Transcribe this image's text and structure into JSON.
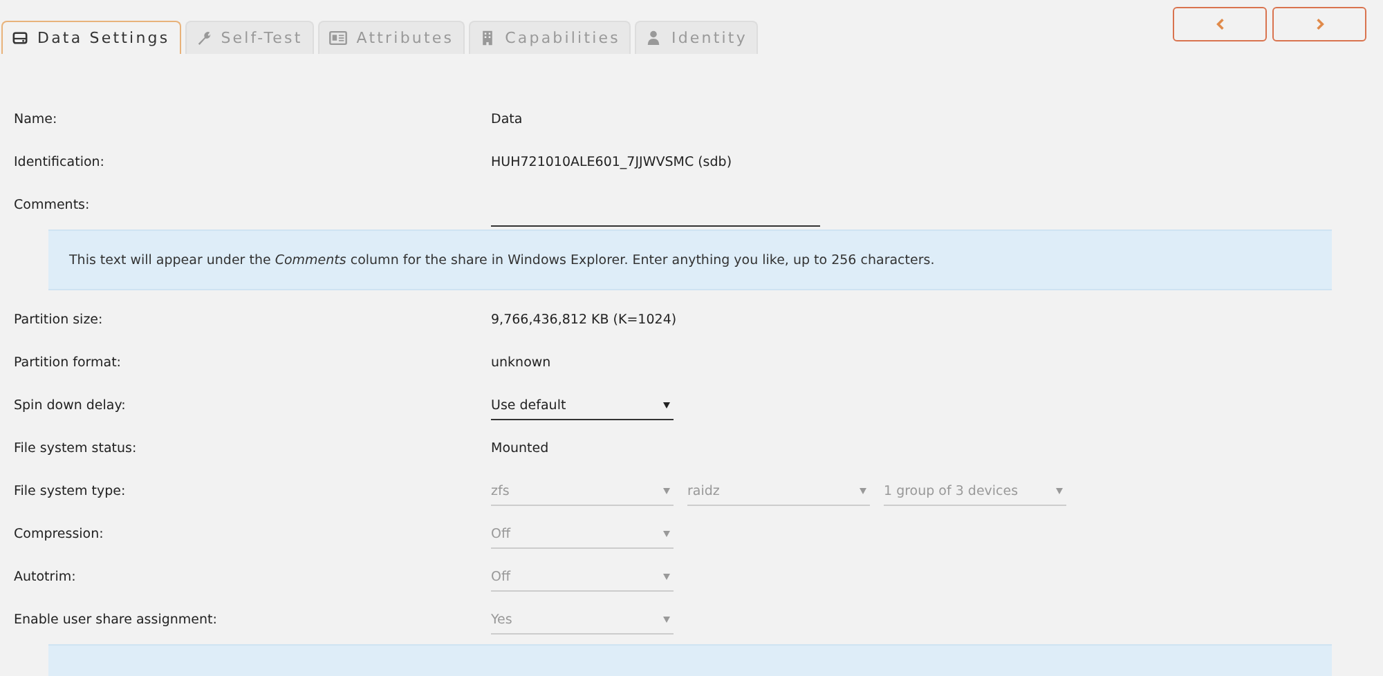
{
  "tabs": [
    {
      "label": "Data Settings",
      "kind": "drive",
      "selected": true
    },
    {
      "label": "Self-Test",
      "kind": "wrench",
      "selected": false
    },
    {
      "label": "Attributes",
      "kind": "card",
      "selected": false
    },
    {
      "label": "Capabilities",
      "kind": "building",
      "selected": false
    },
    {
      "label": "Identity",
      "kind": "user",
      "selected": false
    }
  ],
  "nav": [
    {
      "kind": "previous"
    },
    {
      "kind": "next"
    }
  ],
  "rows": [
    {
      "kind": "text",
      "label": "Name:",
      "value": "Data"
    },
    {
      "kind": "text",
      "label": "Identification:",
      "value": "HUH721010ALE601_7JJWVSMC (sdb)"
    },
    {
      "kind": "input",
      "label": "Comments:"
    },
    {
      "kind": "note",
      "text": "This text will appear under the *Comments* column for the share in Windows Explorer. Enter anything you like, up to 256 characters."
    },
    {
      "kind": "text",
      "label": "Partition size:",
      "value": "9,766,436,812 KB (K=1024)"
    },
    {
      "kind": "text",
      "label": "Partition format:",
      "value": "unknown"
    },
    {
      "kind": "select",
      "label": "Spin down delay:",
      "selects": [
        {
          "value": "Use default",
          "disabled": false
        }
      ]
    },
    {
      "kind": "text",
      "label": "File system status:",
      "value": "Mounted"
    },
    {
      "kind": "select",
      "label": "File system type:",
      "selects": [
        {
          "value": "zfs",
          "disabled": true
        },
        {
          "value": "raidz",
          "disabled": true
        },
        {
          "value": "1 group of 3 devices",
          "disabled": true
        }
      ]
    },
    {
      "kind": "select",
      "label": "Compression:",
      "selects": [
        {
          "value": "Off",
          "disabled": true
        }
      ]
    },
    {
      "kind": "select",
      "label": "Autotrim:",
      "selects": [
        {
          "value": "Off",
          "disabled": true
        }
      ]
    },
    {
      "kind": "select",
      "label": "Enable user share assignment:",
      "selects": [
        {
          "value": "Yes",
          "disabled": true
        }
      ]
    },
    {
      "kind": "note"
    }
  ]
}
